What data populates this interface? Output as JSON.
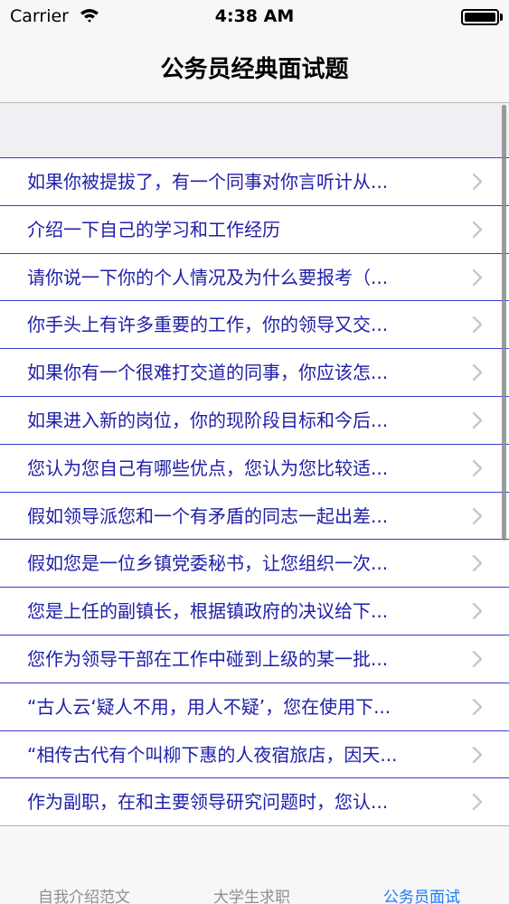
{
  "status_bar": {
    "carrier": "Carrier",
    "time": "4:38 AM",
    "wifi_icon": "wifi-icon",
    "battery_icon": "battery-icon"
  },
  "nav": {
    "title": "公务员经典面试题"
  },
  "list": {
    "chevron_icon": "chevron-right-icon",
    "items": [
      "如果你被提拔了，有一个同事对你言听计从...",
      "介绍一下自己的学习和工作经历",
      "请你说一下你的个人情况及为什么要报考（...",
      "你手头上有许多重要的工作，你的领导又交...",
      "如果你有一个很难打交道的同事，你应该怎...",
      "如果进入新的岗位，你的现阶段目标和今后...",
      "您认为您自己有哪些优点，您认为您比较适...",
      "假如领导派您和一个有矛盾的同志一起出差...",
      "假如您是一位乡镇党委秘书，让您组织一次...",
      "您是上任的副镇长，根据镇政府的决议给下...",
      "您作为领导干部在工作中碰到上级的某一批...",
      "“古人云‘疑人不用，用人不疑’，您在使用下...",
      "“相传古代有个叫柳下惠的人夜宿旅店，因天...",
      "作为副职，在和主要领导研究问题时，您认..."
    ]
  },
  "tab_bar": {
    "tabs": [
      {
        "label": "自我介绍范文",
        "active": false
      },
      {
        "label": "大学生求职",
        "active": false
      },
      {
        "label": "公务员面试",
        "active": true
      }
    ]
  },
  "colors": {
    "row_text": "#2020a8",
    "separator": "#3a3ad0",
    "tab_active": "#1d7bf5",
    "tab_inactive": "#8e8e8e"
  }
}
